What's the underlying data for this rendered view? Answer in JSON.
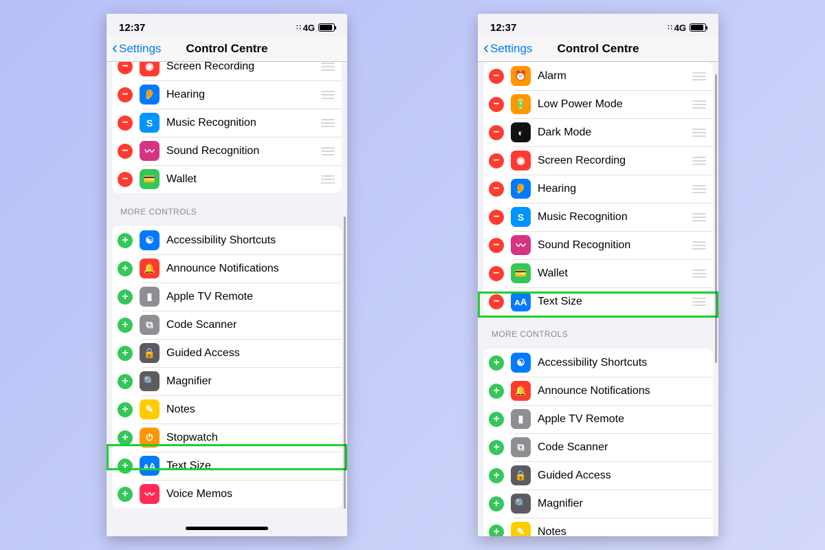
{
  "statusbar": {
    "time": "12:37",
    "net": "4G"
  },
  "nav": {
    "back": "Settings",
    "title": "Control Centre"
  },
  "section_more": "MORE CONTROLS",
  "left": {
    "included": [
      {
        "label": "Screen Recording",
        "icon": "screen-recording-icon",
        "color": "c-red",
        "glyph": "◉"
      },
      {
        "label": "Hearing",
        "icon": "hearing-icon",
        "color": "c-blue",
        "glyph": "👂"
      },
      {
        "label": "Music Recognition",
        "icon": "shazam-icon",
        "color": "c-shazam",
        "glyph": "S"
      },
      {
        "label": "Sound Recognition",
        "icon": "sound-recognition-icon",
        "color": "c-magenta",
        "glyph": "〰"
      },
      {
        "label": "Wallet",
        "icon": "wallet-icon",
        "color": "c-green",
        "glyph": "💳"
      }
    ],
    "more": [
      {
        "label": "Accessibility Shortcuts",
        "icon": "accessibility-icon",
        "color": "c-blue",
        "glyph": "☯"
      },
      {
        "label": "Announce Notifications",
        "icon": "announce-icon",
        "color": "c-red",
        "glyph": "🔔"
      },
      {
        "label": "Apple TV Remote",
        "icon": "appletv-remote-icon",
        "color": "c-gray",
        "glyph": "▮"
      },
      {
        "label": "Code Scanner",
        "icon": "code-scanner-icon",
        "color": "c-gray",
        "glyph": "⧉"
      },
      {
        "label": "Guided Access",
        "icon": "guided-access-icon",
        "color": "c-darkgray",
        "glyph": "🔒"
      },
      {
        "label": "Magnifier",
        "icon": "magnifier-icon",
        "color": "c-darkgray",
        "glyph": "🔍"
      },
      {
        "label": "Notes",
        "icon": "notes-icon",
        "color": "c-yellow",
        "glyph": "✎"
      },
      {
        "label": "Stopwatch",
        "icon": "stopwatch-icon",
        "color": "c-orange",
        "glyph": "⏱"
      },
      {
        "label": "Text Size",
        "icon": "text-size-icon",
        "color": "c-blue",
        "glyph": "ᴀA"
      },
      {
        "label": "Voice Memos",
        "icon": "voice-memos-icon",
        "color": "c-vm",
        "glyph": "〰"
      }
    ],
    "highlight_index": 8
  },
  "right": {
    "included": [
      {
        "label": "Alarm",
        "icon": "alarm-icon",
        "color": "c-orange",
        "glyph": "⏰"
      },
      {
        "label": "Low Power Mode",
        "icon": "low-power-icon",
        "color": "c-orange",
        "glyph": "🔋"
      },
      {
        "label": "Dark Mode",
        "icon": "dark-mode-icon",
        "color": "c-black",
        "glyph": "◐"
      },
      {
        "label": "Screen Recording",
        "icon": "screen-recording-icon",
        "color": "c-red",
        "glyph": "◉"
      },
      {
        "label": "Hearing",
        "icon": "hearing-icon",
        "color": "c-blue",
        "glyph": "👂"
      },
      {
        "label": "Music Recognition",
        "icon": "shazam-icon",
        "color": "c-shazam",
        "glyph": "S"
      },
      {
        "label": "Sound Recognition",
        "icon": "sound-recognition-icon",
        "color": "c-magenta",
        "glyph": "〰"
      },
      {
        "label": "Wallet",
        "icon": "wallet-icon",
        "color": "c-green",
        "glyph": "💳"
      },
      {
        "label": "Text Size",
        "icon": "text-size-icon",
        "color": "c-blue",
        "glyph": "ᴀA"
      }
    ],
    "more": [
      {
        "label": "Accessibility Shortcuts",
        "icon": "accessibility-icon",
        "color": "c-blue",
        "glyph": "☯"
      },
      {
        "label": "Announce Notifications",
        "icon": "announce-icon",
        "color": "c-red",
        "glyph": "🔔"
      },
      {
        "label": "Apple TV Remote",
        "icon": "appletv-remote-icon",
        "color": "c-gray",
        "glyph": "▮"
      },
      {
        "label": "Code Scanner",
        "icon": "code-scanner-icon",
        "color": "c-gray",
        "glyph": "⧉"
      },
      {
        "label": "Guided Access",
        "icon": "guided-access-icon",
        "color": "c-darkgray",
        "glyph": "🔒"
      },
      {
        "label": "Magnifier",
        "icon": "magnifier-icon",
        "color": "c-darkgray",
        "glyph": "🔍"
      },
      {
        "label": "Notes",
        "icon": "notes-icon",
        "color": "c-yellow",
        "glyph": "✎"
      }
    ],
    "highlight_index": 8
  }
}
